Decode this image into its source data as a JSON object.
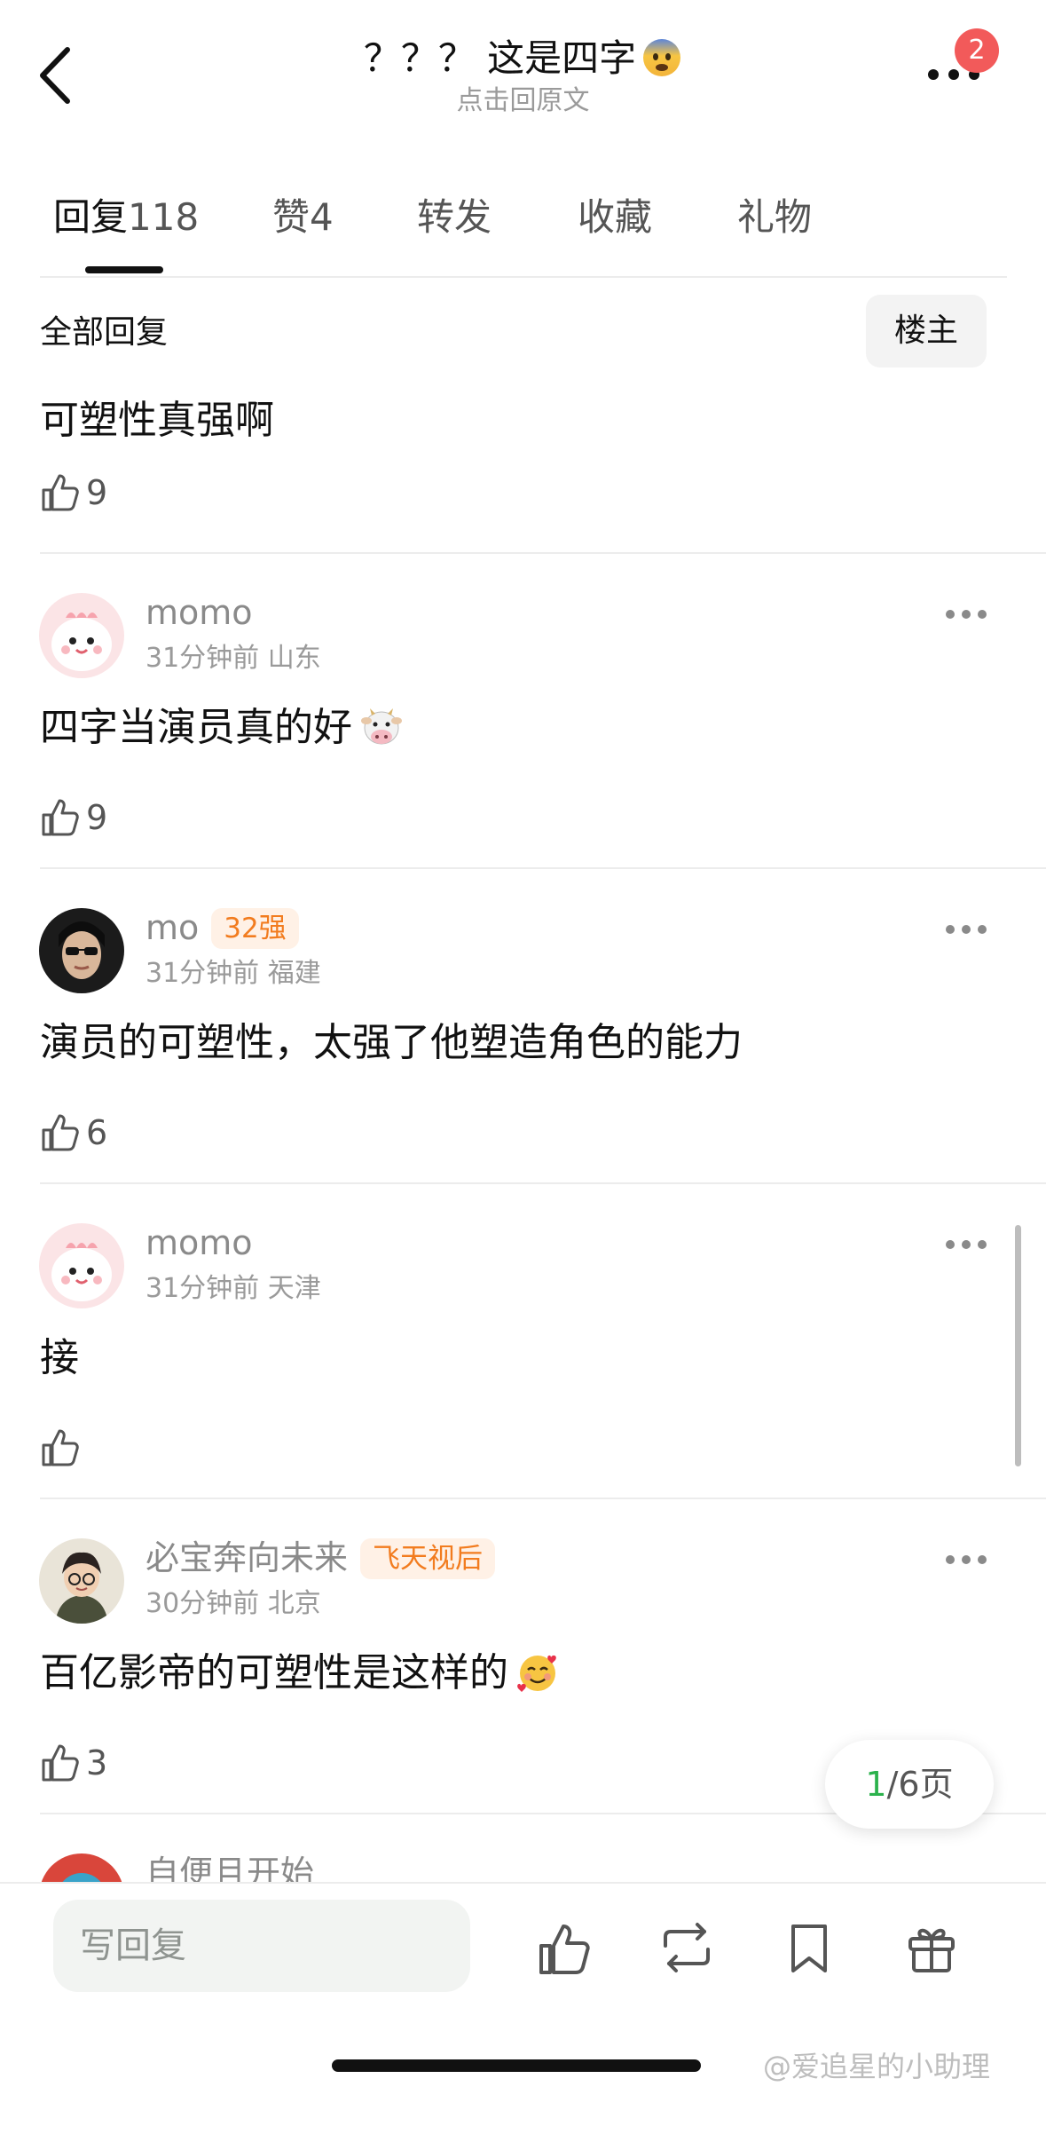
{
  "header": {
    "title": "？？？ 这是四字",
    "title_emoji": "fearful-face-emoji",
    "subtitle": "点击回原文",
    "notification_count": "2"
  },
  "tabs": [
    {
      "label": "回复",
      "count": "118"
    },
    {
      "label": "赞",
      "count": "4"
    },
    {
      "label": "转发",
      "count": ""
    },
    {
      "label": "收藏",
      "count": ""
    },
    {
      "label": "礼物",
      "count": ""
    }
  ],
  "section": {
    "title": "全部回复",
    "filter_label": "楼主"
  },
  "comments": [
    {
      "text": "可塑性真强啊",
      "likes": "9"
    },
    {
      "username": "momo",
      "badge": "",
      "time": "31分钟前",
      "location": "山东",
      "text": "四字当演员真的好",
      "emoji": "cow-face-emoji",
      "likes": "9"
    },
    {
      "username": "mo",
      "badge": "32强",
      "time": "31分钟前",
      "location": "福建",
      "text": "演员的可塑性，太强了他塑造角色的能力",
      "likes": "6"
    },
    {
      "username": "momo",
      "badge": "",
      "time": "31分钟前",
      "location": "天津",
      "text": "接",
      "likes": ""
    },
    {
      "username": "必宝奔向未来",
      "badge": "飞天视后",
      "time": "30分钟前",
      "location": "北京",
      "text": "百亿影帝的可塑性是这样的",
      "emoji": "smiling-face-with-hearts-emoji",
      "likes": "3"
    },
    {
      "username": "自便且开始",
      "partial": true
    }
  ],
  "pager": {
    "current": "1",
    "rest": "/6页"
  },
  "bottom_bar": {
    "reply_placeholder": "写回复",
    "icons": [
      "like-icon",
      "repost-icon",
      "bookmark-icon",
      "gift-icon"
    ]
  },
  "watermark": "@爱追星的小助理",
  "colors": {
    "accent_green": "#2bb24c",
    "badge_orange": "#f27c1f",
    "notif_red": "#f25a5a"
  }
}
